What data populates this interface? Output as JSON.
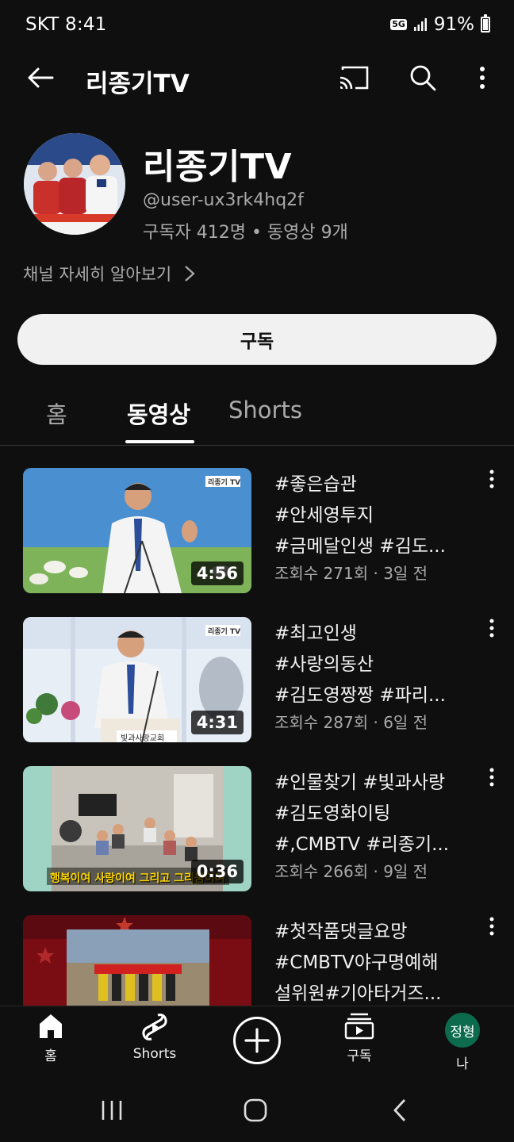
{
  "status_bar": {
    "carrier_time": "SKT 8:41",
    "network": "5G",
    "battery": "91%"
  },
  "app_bar": {
    "title": "리종기TV"
  },
  "channel": {
    "name": "리종기TV",
    "handle": "@user-ux3rk4hq2f",
    "stats": "구독자 412명 • 동영상 9개",
    "more_link": "채널 자세히 알아보기"
  },
  "subscribe_label": "구독",
  "tabs": [
    {
      "label": "홈",
      "active": false
    },
    {
      "label": "동영상",
      "active": true
    },
    {
      "label": "Shorts",
      "active": false
    }
  ],
  "videos": [
    {
      "title_lines": [
        "#좋은습관",
        "#안세영투지",
        "#금메달인생 #김도..."
      ],
      "meta": "조회수 271회 · 3일 전",
      "duration": "4:56",
      "watermark": "리종기 TV"
    },
    {
      "title_lines": [
        "#최고인생",
        "#사랑의동산",
        "#김도영짱짱 #파리..."
      ],
      "meta": "조회수 287회 · 6일 전",
      "duration": "4:31",
      "watermark": "리종기 TV",
      "podium_sign": "빛과사랑교회"
    },
    {
      "title_lines": [
        "#인물찾기 #빛과사랑",
        "#김도영화이팅",
        "#,CMBTV #리종기..."
      ],
      "meta": "조회수 266회 · 9일 전",
      "duration": "0:36",
      "caption": "행복이여 사랑이여 그리고 그리움이여"
    },
    {
      "title_lines": [
        "#첫작품댓글요망",
        "#CMBTV야구명예해",
        "설위원#기아타거즈..."
      ]
    }
  ],
  "bottom_nav": {
    "home": "홈",
    "shorts": "Shorts",
    "subscriptions": "구독",
    "you": "나",
    "you_avatar": "정형"
  },
  "colors": {
    "background": "#0f0f0f",
    "text_secondary": "#aaaaaa",
    "avatar_green": "#0b6b4c"
  }
}
